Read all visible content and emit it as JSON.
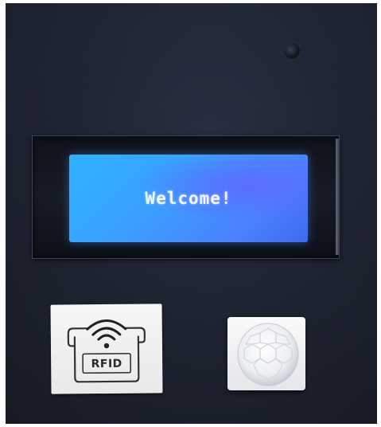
{
  "lcd": {
    "text": "Welcome!"
  },
  "rfid": {
    "label": "RFID",
    "icon": "wireless-signal-icon"
  },
  "colors": {
    "panel": "#222838",
    "lcd_backlight": "#3aa0ff",
    "lcd_text": "#f2f6ff",
    "card": "#f2f2f2"
  }
}
